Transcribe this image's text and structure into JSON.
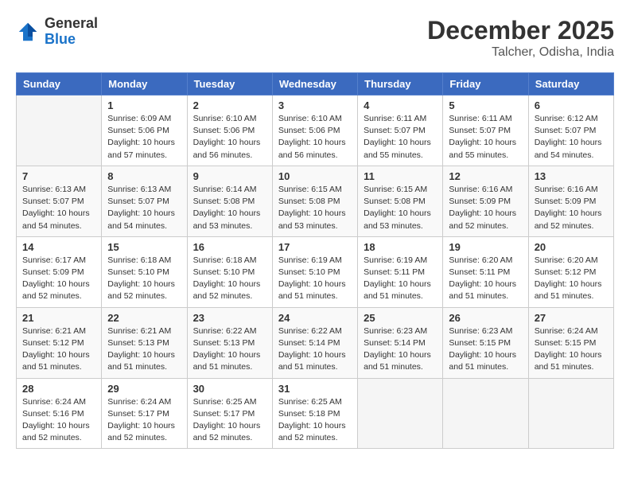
{
  "header": {
    "logo_general": "General",
    "logo_blue": "Blue",
    "month_year": "December 2025",
    "location": "Talcher, Odisha, India"
  },
  "days_of_week": [
    "Sunday",
    "Monday",
    "Tuesday",
    "Wednesday",
    "Thursday",
    "Friday",
    "Saturday"
  ],
  "weeks": [
    [
      {
        "day": "",
        "sunrise": "",
        "sunset": "",
        "daylight": ""
      },
      {
        "day": "1",
        "sunrise": "Sunrise: 6:09 AM",
        "sunset": "Sunset: 5:06 PM",
        "daylight": "Daylight: 10 hours and 57 minutes."
      },
      {
        "day": "2",
        "sunrise": "Sunrise: 6:10 AM",
        "sunset": "Sunset: 5:06 PM",
        "daylight": "Daylight: 10 hours and 56 minutes."
      },
      {
        "day": "3",
        "sunrise": "Sunrise: 6:10 AM",
        "sunset": "Sunset: 5:06 PM",
        "daylight": "Daylight: 10 hours and 56 minutes."
      },
      {
        "day": "4",
        "sunrise": "Sunrise: 6:11 AM",
        "sunset": "Sunset: 5:07 PM",
        "daylight": "Daylight: 10 hours and 55 minutes."
      },
      {
        "day": "5",
        "sunrise": "Sunrise: 6:11 AM",
        "sunset": "Sunset: 5:07 PM",
        "daylight": "Daylight: 10 hours and 55 minutes."
      },
      {
        "day": "6",
        "sunrise": "Sunrise: 6:12 AM",
        "sunset": "Sunset: 5:07 PM",
        "daylight": "Daylight: 10 hours and 54 minutes."
      }
    ],
    [
      {
        "day": "7",
        "sunrise": "Sunrise: 6:13 AM",
        "sunset": "Sunset: 5:07 PM",
        "daylight": "Daylight: 10 hours and 54 minutes."
      },
      {
        "day": "8",
        "sunrise": "Sunrise: 6:13 AM",
        "sunset": "Sunset: 5:07 PM",
        "daylight": "Daylight: 10 hours and 54 minutes."
      },
      {
        "day": "9",
        "sunrise": "Sunrise: 6:14 AM",
        "sunset": "Sunset: 5:08 PM",
        "daylight": "Daylight: 10 hours and 53 minutes."
      },
      {
        "day": "10",
        "sunrise": "Sunrise: 6:15 AM",
        "sunset": "Sunset: 5:08 PM",
        "daylight": "Daylight: 10 hours and 53 minutes."
      },
      {
        "day": "11",
        "sunrise": "Sunrise: 6:15 AM",
        "sunset": "Sunset: 5:08 PM",
        "daylight": "Daylight: 10 hours and 53 minutes."
      },
      {
        "day": "12",
        "sunrise": "Sunrise: 6:16 AM",
        "sunset": "Sunset: 5:09 PM",
        "daylight": "Daylight: 10 hours and 52 minutes."
      },
      {
        "day": "13",
        "sunrise": "Sunrise: 6:16 AM",
        "sunset": "Sunset: 5:09 PM",
        "daylight": "Daylight: 10 hours and 52 minutes."
      }
    ],
    [
      {
        "day": "14",
        "sunrise": "Sunrise: 6:17 AM",
        "sunset": "Sunset: 5:09 PM",
        "daylight": "Daylight: 10 hours and 52 minutes."
      },
      {
        "day": "15",
        "sunrise": "Sunrise: 6:18 AM",
        "sunset": "Sunset: 5:10 PM",
        "daylight": "Daylight: 10 hours and 52 minutes."
      },
      {
        "day": "16",
        "sunrise": "Sunrise: 6:18 AM",
        "sunset": "Sunset: 5:10 PM",
        "daylight": "Daylight: 10 hours and 52 minutes."
      },
      {
        "day": "17",
        "sunrise": "Sunrise: 6:19 AM",
        "sunset": "Sunset: 5:10 PM",
        "daylight": "Daylight: 10 hours and 51 minutes."
      },
      {
        "day": "18",
        "sunrise": "Sunrise: 6:19 AM",
        "sunset": "Sunset: 5:11 PM",
        "daylight": "Daylight: 10 hours and 51 minutes."
      },
      {
        "day": "19",
        "sunrise": "Sunrise: 6:20 AM",
        "sunset": "Sunset: 5:11 PM",
        "daylight": "Daylight: 10 hours and 51 minutes."
      },
      {
        "day": "20",
        "sunrise": "Sunrise: 6:20 AM",
        "sunset": "Sunset: 5:12 PM",
        "daylight": "Daylight: 10 hours and 51 minutes."
      }
    ],
    [
      {
        "day": "21",
        "sunrise": "Sunrise: 6:21 AM",
        "sunset": "Sunset: 5:12 PM",
        "daylight": "Daylight: 10 hours and 51 minutes."
      },
      {
        "day": "22",
        "sunrise": "Sunrise: 6:21 AM",
        "sunset": "Sunset: 5:13 PM",
        "daylight": "Daylight: 10 hours and 51 minutes."
      },
      {
        "day": "23",
        "sunrise": "Sunrise: 6:22 AM",
        "sunset": "Sunset: 5:13 PM",
        "daylight": "Daylight: 10 hours and 51 minutes."
      },
      {
        "day": "24",
        "sunrise": "Sunrise: 6:22 AM",
        "sunset": "Sunset: 5:14 PM",
        "daylight": "Daylight: 10 hours and 51 minutes."
      },
      {
        "day": "25",
        "sunrise": "Sunrise: 6:23 AM",
        "sunset": "Sunset: 5:14 PM",
        "daylight": "Daylight: 10 hours and 51 minutes."
      },
      {
        "day": "26",
        "sunrise": "Sunrise: 6:23 AM",
        "sunset": "Sunset: 5:15 PM",
        "daylight": "Daylight: 10 hours and 51 minutes."
      },
      {
        "day": "27",
        "sunrise": "Sunrise: 6:24 AM",
        "sunset": "Sunset: 5:15 PM",
        "daylight": "Daylight: 10 hours and 51 minutes."
      }
    ],
    [
      {
        "day": "28",
        "sunrise": "Sunrise: 6:24 AM",
        "sunset": "Sunset: 5:16 PM",
        "daylight": "Daylight: 10 hours and 52 minutes."
      },
      {
        "day": "29",
        "sunrise": "Sunrise: 6:24 AM",
        "sunset": "Sunset: 5:17 PM",
        "daylight": "Daylight: 10 hours and 52 minutes."
      },
      {
        "day": "30",
        "sunrise": "Sunrise: 6:25 AM",
        "sunset": "Sunset: 5:17 PM",
        "daylight": "Daylight: 10 hours and 52 minutes."
      },
      {
        "day": "31",
        "sunrise": "Sunrise: 6:25 AM",
        "sunset": "Sunset: 5:18 PM",
        "daylight": "Daylight: 10 hours and 52 minutes."
      },
      {
        "day": "",
        "sunrise": "",
        "sunset": "",
        "daylight": ""
      },
      {
        "day": "",
        "sunrise": "",
        "sunset": "",
        "daylight": ""
      },
      {
        "day": "",
        "sunrise": "",
        "sunset": "",
        "daylight": ""
      }
    ]
  ]
}
